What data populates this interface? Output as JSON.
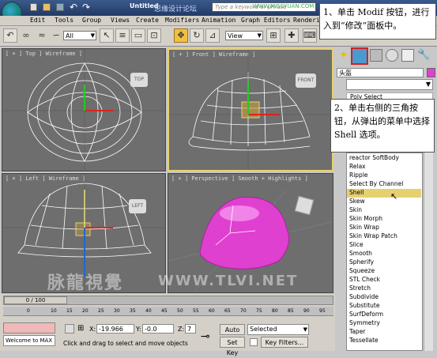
{
  "titlebar": {
    "title": "Untitled",
    "watermark_top": "思缘设计论坛",
    "search_placeholder": "Type a keyword or phrase",
    "watermark_site": "WWW.MISSYUAN.COM"
  },
  "menu": [
    "Edit",
    "Tools",
    "Group",
    "Views",
    "Create",
    "Modifiers",
    "Animation",
    "Graph Editors",
    "Rendering"
  ],
  "toolbar": {
    "selection_filter": "All",
    "ref_coord": "View"
  },
  "viewports": {
    "top": "[ + ] Top ] Wireframe ]",
    "front": "[ + ] Front ] Wireframe ]",
    "left": "[ + ] Left ] Wireframe ]",
    "persp": "[ + ] Perspective ] Smooth + Highlights ]"
  },
  "viewcube": {
    "top": "TOP",
    "front": "FRONT",
    "left": "LEFT"
  },
  "rpanel": {
    "object_name": "头盔",
    "top_item": "Poly Select"
  },
  "modifiers": [
    "reactor SoftBody",
    "Relax",
    "Ripple",
    "Select By Channel",
    "Shell",
    "Skew",
    "Skin",
    "Skin Morph",
    "Skin Wrap",
    "Skin Wrap Patch",
    "Slice",
    "Smooth",
    "Spherify",
    "Squeeze",
    "STL Check",
    "Stretch",
    "Subdivide",
    "Substitute",
    "SurfDeform",
    "Symmetry",
    "Taper",
    "Tessellate"
  ],
  "selected_modifier": "Shell",
  "callouts": {
    "one": "1、单击 Modif 按钮，进行入到“修改”面板中。",
    "two": "2、单击右侧的三角按钮，从弹出的菜单中选择 Shell 选项。"
  },
  "timeline": {
    "frame": "0 / 100",
    "ticks": [
      "0",
      "10",
      "15",
      "20",
      "25",
      "30",
      "35",
      "40",
      "45",
      "50",
      "55",
      "60",
      "65",
      "70",
      "75",
      "80",
      "85",
      "90",
      "95"
    ]
  },
  "status": {
    "maxscript": "Welcome to MAX",
    "x_label": "X:",
    "x_value": "-19.966",
    "y_label": "Y:",
    "y_value": "-0.0",
    "z_label": "Z:",
    "z_value": "7",
    "auto_key": "Auto Key",
    "set_key": "Set Key",
    "key_mode": "Selected",
    "key_filters": "Key Filters...",
    "prompt": "Click and drag to select and move objects"
  },
  "watermark": {
    "logo": "脉龍視覺",
    "site": "WWW.TLVI.NET"
  },
  "colors": {
    "accent_red": "#d42020",
    "mesh_magenta": "#e040d0",
    "selected_yellow": "#e6d070"
  }
}
